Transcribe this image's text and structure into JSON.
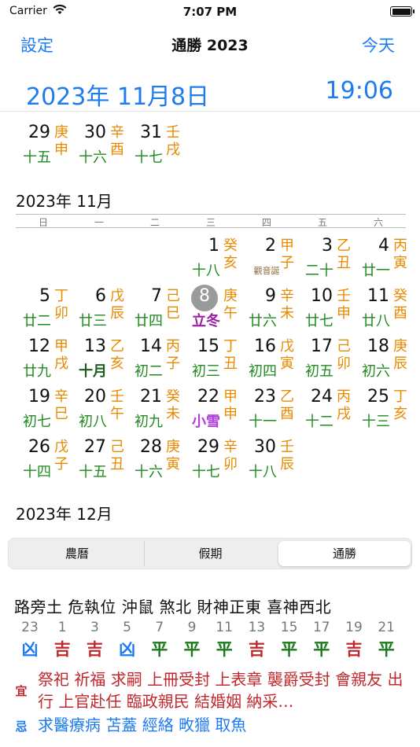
{
  "status": {
    "carrier": "Carrier",
    "time": "7:07 PM"
  },
  "nav": {
    "left": "設定",
    "title": "通勝 2023",
    "right": "今天"
  },
  "datebar": {
    "date": "2023年 11月8日",
    "clock": "19:06"
  },
  "weekdays": [
    "日",
    "一",
    "二",
    "三",
    "四",
    "五",
    "六"
  ],
  "oct_tail": [
    {
      "day": "29",
      "lunar": "十五",
      "gz": "庚申"
    },
    {
      "day": "30",
      "lunar": "十六",
      "gz": "辛酉"
    },
    {
      "day": "31",
      "lunar": "十七",
      "gz": "壬戌"
    }
  ],
  "nov_title": "2023年 11月",
  "dec_title": "2023年 12月",
  "nov_days": [
    {
      "day": "1",
      "lunar": "十八",
      "gz": "癸亥"
    },
    {
      "day": "2",
      "fest": "觀音誕",
      "gz": "甲子"
    },
    {
      "day": "3",
      "lunar": "二十",
      "gz": "乙丑"
    },
    {
      "day": "4",
      "lunar": "廿一",
      "gz": "丙寅"
    },
    {
      "day": "5",
      "lunar": "廿二",
      "gz": "丁卯"
    },
    {
      "day": "6",
      "lunar": "廿三",
      "gz": "戊辰"
    },
    {
      "day": "7",
      "lunar": "廿四",
      "gz": "己巳"
    },
    {
      "day": "8",
      "term": "立冬",
      "gz": "庚午",
      "today": true
    },
    {
      "day": "9",
      "lunar": "廿六",
      "gz": "辛未"
    },
    {
      "day": "10",
      "lunar": "廿七",
      "gz": "壬申"
    },
    {
      "day": "11",
      "lunar": "廿八",
      "gz": "癸酉"
    },
    {
      "day": "12",
      "lunar": "廿九",
      "gz": "甲戌"
    },
    {
      "day": "13",
      "lunar": "十月",
      "gz": "乙亥",
      "bold": true
    },
    {
      "day": "14",
      "lunar": "初二",
      "gz": "丙子"
    },
    {
      "day": "15",
      "lunar": "初三",
      "gz": "丁丑"
    },
    {
      "day": "16",
      "lunar": "初四",
      "gz": "戊寅"
    },
    {
      "day": "17",
      "lunar": "初五",
      "gz": "己卯"
    },
    {
      "day": "18",
      "lunar": "初六",
      "gz": "庚辰"
    },
    {
      "day": "19",
      "lunar": "初七",
      "gz": "辛巳"
    },
    {
      "day": "20",
      "lunar": "初八",
      "gz": "壬午"
    },
    {
      "day": "21",
      "lunar": "初九",
      "gz": "癸未"
    },
    {
      "day": "22",
      "term": "小雪",
      "gz": "甲申",
      "light": true
    },
    {
      "day": "23",
      "lunar": "十一",
      "gz": "乙酉"
    },
    {
      "day": "24",
      "lunar": "十二",
      "gz": "丙戌"
    },
    {
      "day": "25",
      "lunar": "十三",
      "gz": "丁亥"
    },
    {
      "day": "26",
      "lunar": "十四",
      "gz": "戊子"
    },
    {
      "day": "27",
      "lunar": "十五",
      "gz": "己丑"
    },
    {
      "day": "28",
      "lunar": "十六",
      "gz": "庚寅"
    },
    {
      "day": "29",
      "lunar": "十七",
      "gz": "辛卯"
    },
    {
      "day": "30",
      "lunar": "十八",
      "gz": "壬辰"
    }
  ],
  "segments": [
    "農曆",
    "假期",
    "通勝"
  ],
  "info_line": "路旁土 危執位  沖鼠 煞北  財神正東 喜神西北",
  "hours": [
    {
      "h": "23",
      "v": "凶",
      "c": "#1e7bf0"
    },
    {
      "h": "1",
      "v": "吉",
      "c": "#c0282d"
    },
    {
      "h": "3",
      "v": "吉",
      "c": "#c0282d"
    },
    {
      "h": "5",
      "v": "凶",
      "c": "#1e7bf0"
    },
    {
      "h": "7",
      "v": "平",
      "c": "#1a7a1a"
    },
    {
      "h": "9",
      "v": "平",
      "c": "#1a7a1a"
    },
    {
      "h": "11",
      "v": "平",
      "c": "#1a7a1a"
    },
    {
      "h": "13",
      "v": "吉",
      "c": "#c0282d"
    },
    {
      "h": "15",
      "v": "平",
      "c": "#1a7a1a"
    },
    {
      "h": "17",
      "v": "平",
      "c": "#1a7a1a"
    },
    {
      "h": "19",
      "v": "吉",
      "c": "#c0282d"
    },
    {
      "h": "21",
      "v": "平",
      "c": "#1a7a1a"
    }
  ],
  "yi": {
    "tag": "宜",
    "text": "祭祀 祈福 求嗣 上冊受封 上表章 襲爵受封 會親友 出行 上官赴任 臨政親民 結婚姻 納采…"
  },
  "ji": {
    "tag": "忌",
    "text": "求醫療病 苫蓋 經絡 畋獵 取魚"
  }
}
